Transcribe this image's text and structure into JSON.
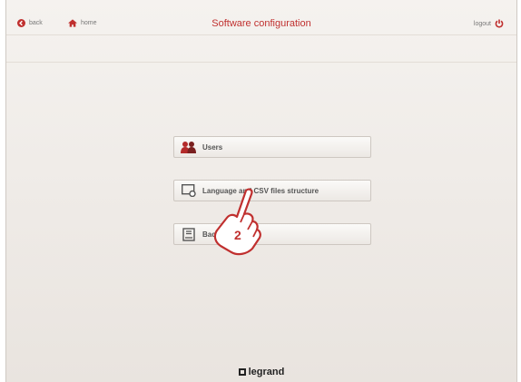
{
  "header": {
    "back_label": "back",
    "home_label": "home",
    "title": "Software configuration",
    "logout_label": "logout"
  },
  "menu": {
    "items": [
      {
        "label": "Users",
        "icon": "users-icon"
      },
      {
        "label": "Language and CSV files structure",
        "icon": "language-csv-icon"
      },
      {
        "label": "Backup/restore",
        "icon": "backup-icon"
      }
    ]
  },
  "callout": {
    "number": "2"
  },
  "footer": {
    "brand": "legrand"
  },
  "colors": {
    "accent": "#c0302f",
    "background": "#efebe7"
  }
}
